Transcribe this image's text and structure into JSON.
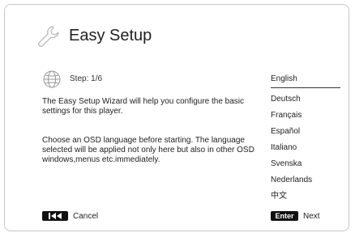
{
  "header": {
    "title": "Easy Setup",
    "icon": "wrench-icon"
  },
  "step": {
    "label": "Step: 1/6",
    "icon": "globe-icon"
  },
  "body": {
    "paragraph1": "The Easy Setup Wizard will help you configure the basic settings for this player.",
    "paragraph2": "Choose an OSD language before starting. The language selected will be applied not only here but also in other OSD windows,menus etc.immediately."
  },
  "languages": {
    "selected": "English",
    "items": [
      "English",
      "Deutsch",
      "Français",
      "Español",
      "Italiano",
      "Svenska",
      "Nederlands",
      "中文"
    ]
  },
  "footer": {
    "cancel_key_icon": "previous-track-icon",
    "cancel_label": "Cancel",
    "enter_key_label": "Enter",
    "next_label": "Next"
  }
}
